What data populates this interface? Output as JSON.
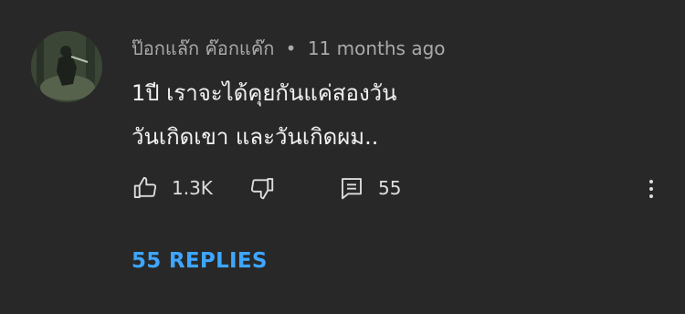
{
  "comment": {
    "author": "ป๊อกแล๊ก ค๊อกแค๊ก",
    "separator": "•",
    "timestamp": "11 months ago",
    "text_lines": [
      "1ปี เราจะได้คุยกันแค่สองวัน",
      "วันเกิดเขา และวันเกิดผม.."
    ],
    "likes": "1.3K",
    "reply_count": "55",
    "replies_link": "55 REPLIES"
  },
  "icons": {
    "like": "thumbs-up-icon",
    "dislike": "thumbs-down-icon",
    "reply": "comment-icon",
    "more": "more-vert-icon"
  },
  "colors": {
    "background": "#282828",
    "meta_text": "#aaaaaa",
    "body_text": "#f1f1f1",
    "link": "#3ea6ff"
  }
}
